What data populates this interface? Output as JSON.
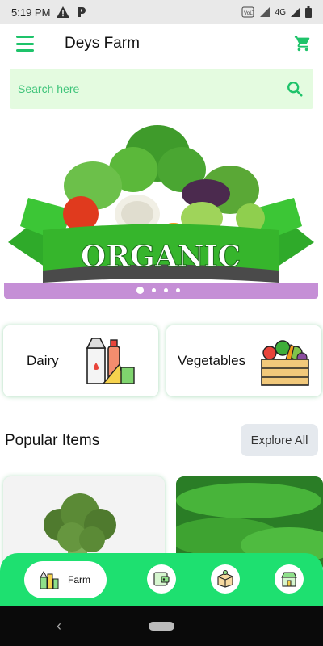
{
  "status_bar": {
    "time": "5:19 PM",
    "network_label": "4G"
  },
  "app_bar": {
    "title": "Deys Farm",
    "menu_icon": "hamburger-menu-icon",
    "cart_icon": "shopping-cart-icon"
  },
  "search": {
    "placeholder": "Search here",
    "icon": "search-icon"
  },
  "banner": {
    "text": "ORGANIC",
    "slides": 4,
    "active_slide": 1
  },
  "categories": [
    {
      "label": "Dairy",
      "icon": "dairy-products-icon"
    },
    {
      "label": "Vegetables",
      "icon": "vegetable-crate-icon"
    }
  ],
  "popular": {
    "title": "Popular Items",
    "explore_label": "Explore All",
    "items": [
      {
        "image": "broccoli-image"
      },
      {
        "image": "bitter-gourd-image"
      }
    ]
  },
  "bottom_nav": {
    "items": [
      {
        "label": "Farm",
        "icon": "farm-products-icon",
        "active": true
      },
      {
        "label": "",
        "icon": "wallet-icon",
        "active": false
      },
      {
        "label": "",
        "icon": "delivery-box-icon",
        "active": false
      },
      {
        "label": "",
        "icon": "store-icon",
        "active": false
      }
    ]
  },
  "colors": {
    "accent": "#1ec36a",
    "nav_green": "#1ee070",
    "search_bg": "#e4fbe0",
    "banner_strip": "#c58fd6"
  }
}
